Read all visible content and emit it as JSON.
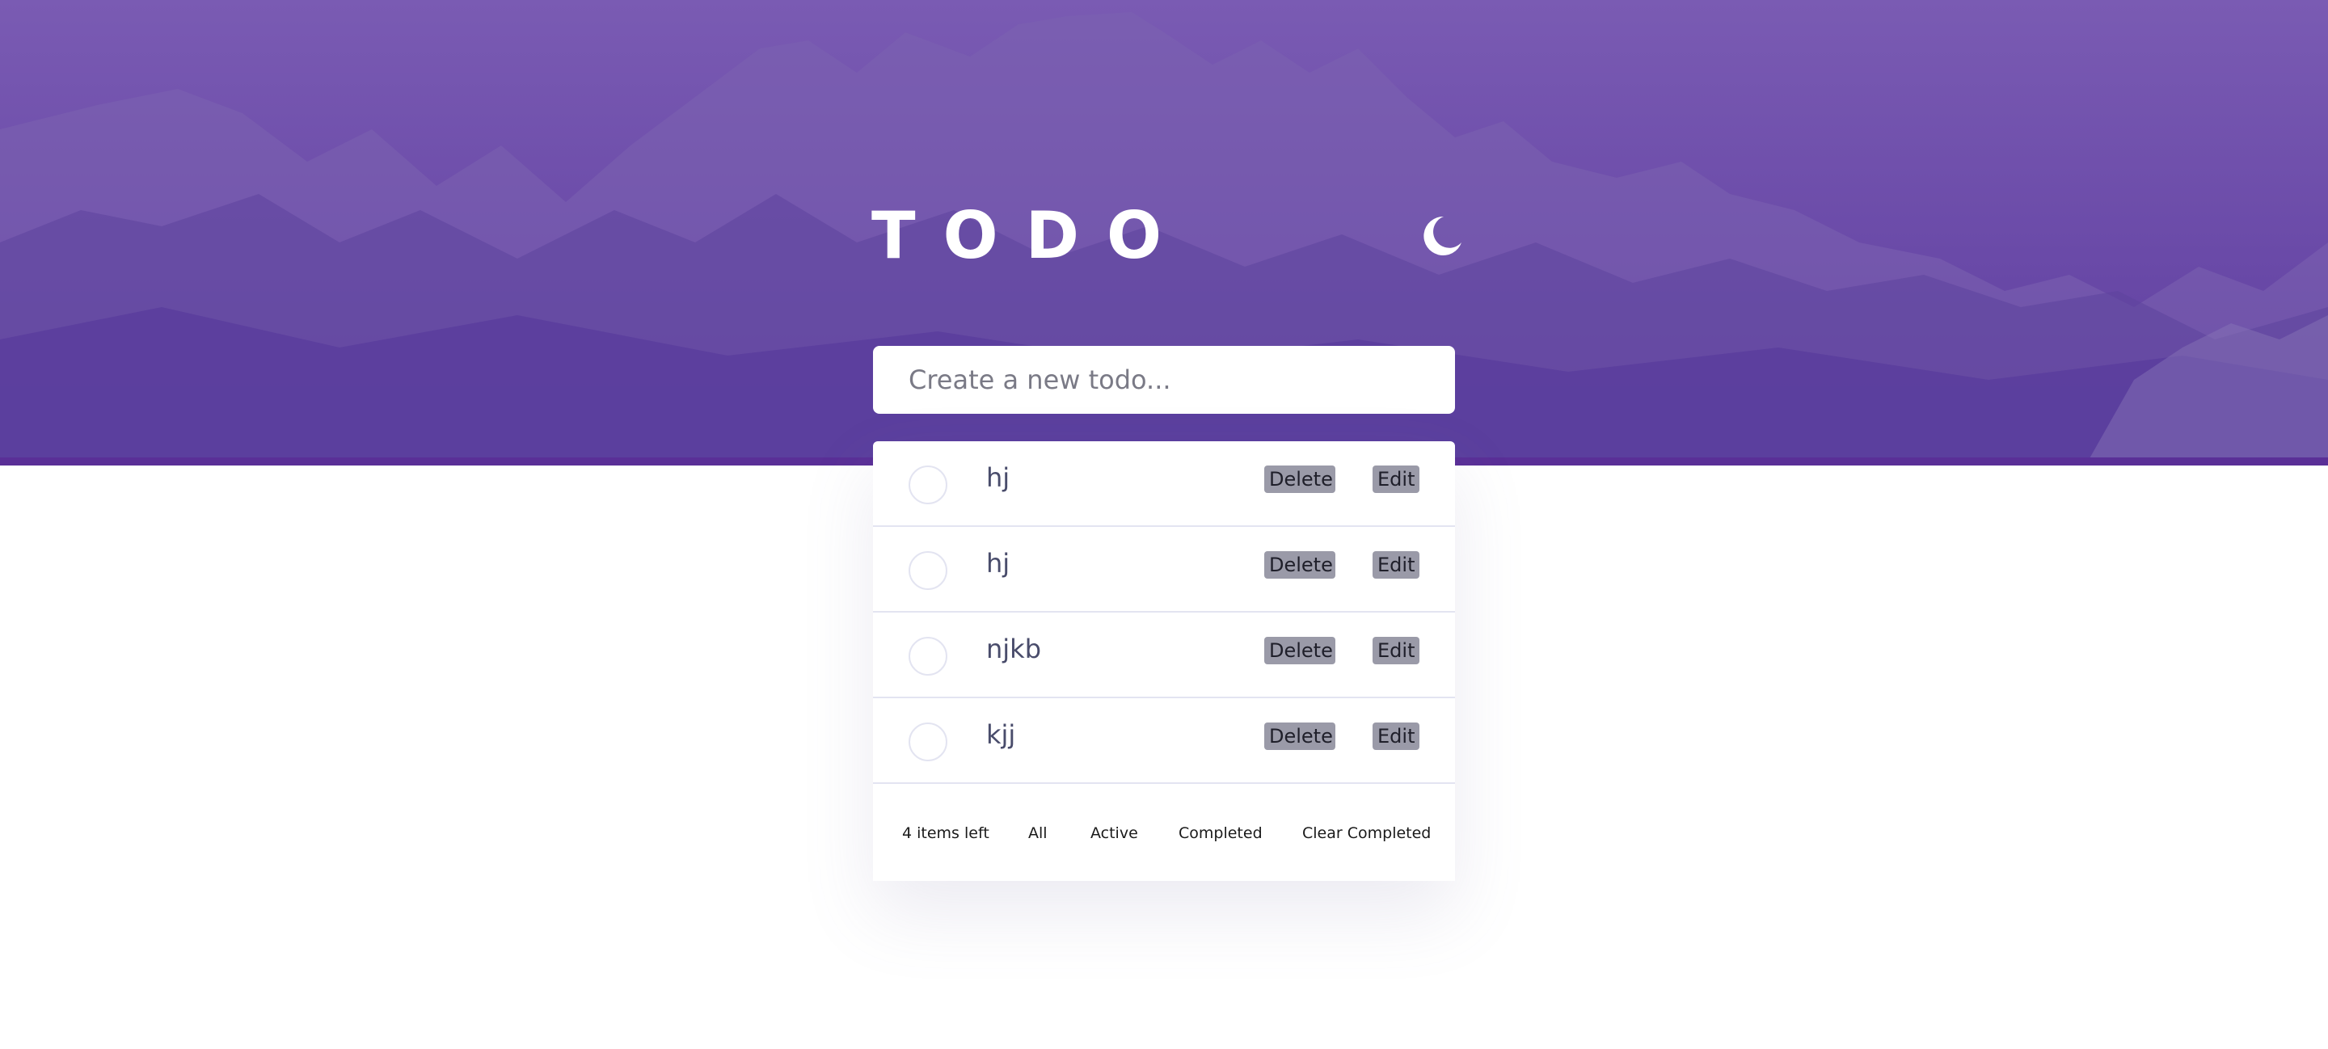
{
  "app": {
    "title": "TODO"
  },
  "theme_toggle": {
    "icon": "moon-icon"
  },
  "new_todo": {
    "placeholder": "Create a new todo..."
  },
  "todos": [
    {
      "text": "hj",
      "delete_label": "Delete",
      "edit_label": "Edit",
      "completed": false
    },
    {
      "text": "hj",
      "delete_label": "Delete",
      "edit_label": "Edit",
      "completed": false
    },
    {
      "text": "njkb",
      "delete_label": "Delete",
      "edit_label": "Edit",
      "completed": false
    },
    {
      "text": "kjj",
      "delete_label": "Delete",
      "edit_label": "Edit",
      "completed": false
    }
  ],
  "footer": {
    "items_left": "4 items left",
    "filters": [
      "All",
      "Active",
      "Completed"
    ],
    "clear_label": "Clear Completed"
  },
  "colors": {
    "hero_purple": "#6a4aa8",
    "text_dark": "#494c6b",
    "button_gray": "#9a9aa8",
    "divider": "#e3e4f1"
  }
}
